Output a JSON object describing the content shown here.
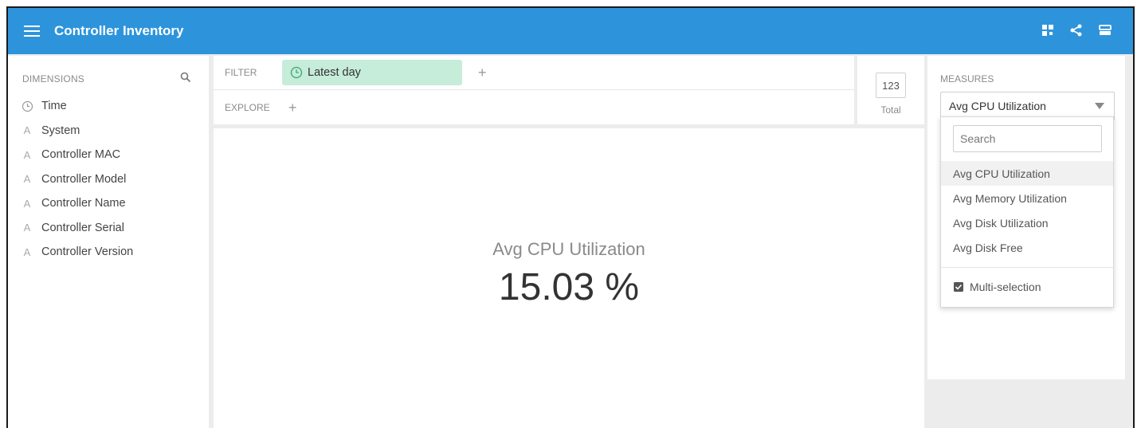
{
  "header": {
    "title": "Controller Inventory",
    "icons": [
      "hamburger-menu-icon",
      "grid-view-icon",
      "share-icon",
      "settings-panel-icon"
    ]
  },
  "dimensions": {
    "heading": "DIMENSIONS",
    "items": [
      {
        "label": "Time",
        "icon": "clock-icon"
      },
      {
        "label": "System",
        "icon": "string-dimension-icon"
      },
      {
        "label": "Controller MAC",
        "icon": "string-dimension-icon"
      },
      {
        "label": "Controller Model",
        "icon": "string-dimension-icon"
      },
      {
        "label": "Controller Name",
        "icon": "string-dimension-icon"
      },
      {
        "label": "Controller Serial",
        "icon": "string-dimension-icon"
      },
      {
        "label": "Controller Version",
        "icon": "string-dimension-icon"
      }
    ]
  },
  "filter": {
    "label": "FILTER",
    "chip": "Latest day"
  },
  "explore": {
    "label": "EXPLORE"
  },
  "total": {
    "value": "123",
    "label": "Total"
  },
  "visualization": {
    "measure_label": "Avg CPU Utilization",
    "value": "15.03 %"
  },
  "measures": {
    "heading": "MEASURES",
    "selected": "Avg CPU Utilization",
    "search_placeholder": "Search",
    "options": [
      "Avg CPU Utilization",
      "Avg Memory Utilization",
      "Avg Disk Utilization",
      "Avg Disk Free"
    ],
    "multi_selection_label": "Multi-selection"
  },
  "colors": {
    "topbar": "#2d94dc",
    "filter_chip": "#c6ecda",
    "background": "#ececec"
  }
}
